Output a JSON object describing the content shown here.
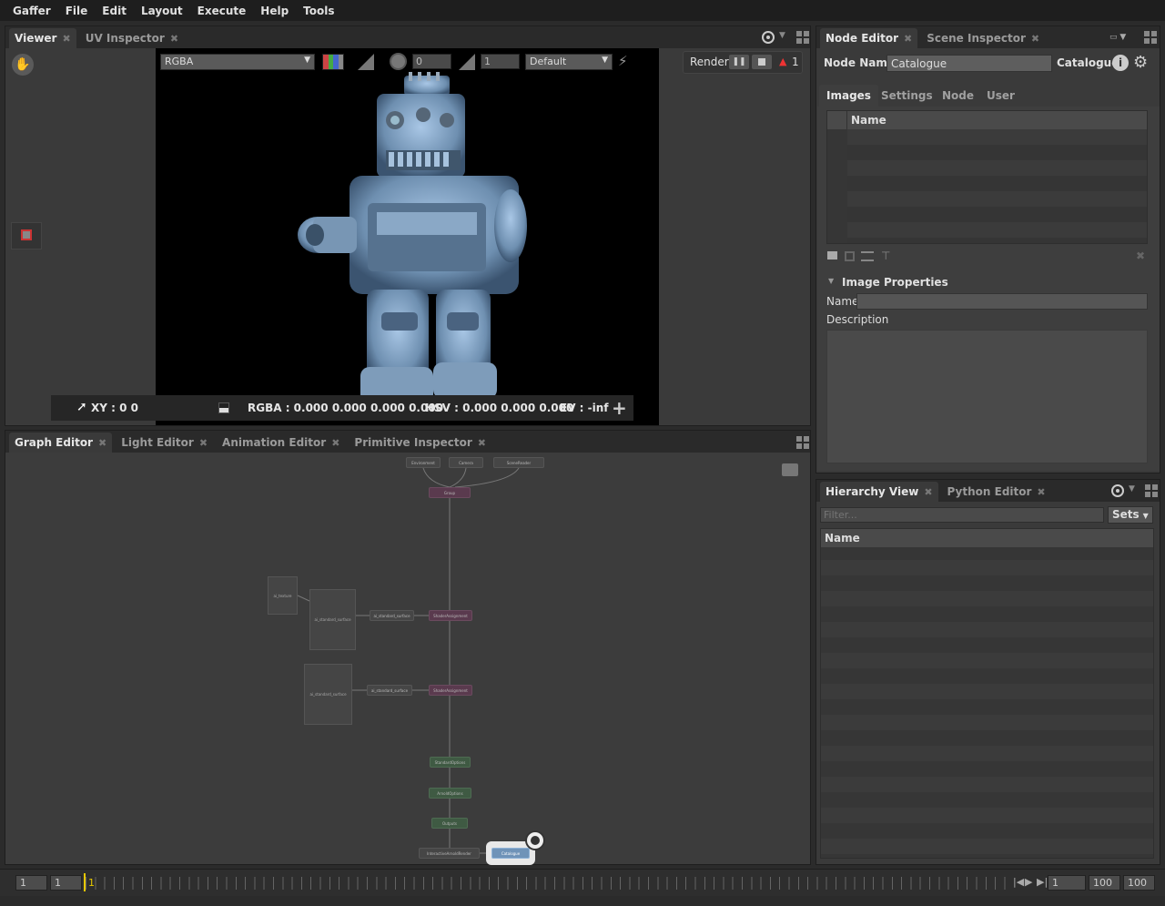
{
  "menubar": [
    "Gaffer",
    "File",
    "Edit",
    "Layout",
    "Execute",
    "Help",
    "Tools"
  ],
  "viewer": {
    "tabs": [
      {
        "label": "Viewer"
      },
      {
        "label": "UV Inspector"
      }
    ],
    "channels": "RGBA",
    "exposure": "0",
    "gamma": "1",
    "display": "Default",
    "render_label": "Render",
    "error_count": "1",
    "pixel": {
      "xy": "XY : 0 0",
      "rgba": "RGBA : 0.000 0.000 0.000 0.000",
      "hsv": "HSV : 0.000 0.000 0.000",
      "ev": "EV : -inf"
    }
  },
  "node_editor": {
    "tabs": [
      {
        "label": "Node Editor"
      },
      {
        "label": "Scene Inspector"
      }
    ],
    "node_name_label": "Node Name",
    "node_name_value": "Catalogue",
    "node_type": "Catalogue",
    "subtabs": [
      "Images",
      "Settings",
      "Node",
      "User"
    ],
    "table_header": "Name",
    "section_title": "Image Properties",
    "name_label": "Name",
    "name_value": "",
    "description_label": "Description"
  },
  "graph_editor": {
    "tabs": [
      {
        "label": "Graph Editor"
      },
      {
        "label": "Light Editor"
      },
      {
        "label": "Animation Editor"
      },
      {
        "label": "Primitive Inspector"
      }
    ],
    "nodes": {
      "top1": "Environment",
      "top2": "Camera",
      "top3": "SceneReader",
      "group": "Group",
      "shader1": "ai_texture",
      "shader2": "ai_standard_surface",
      "assign1a": "ai_standard_surface",
      "assign1b": "ShaderAssignment",
      "shader3": "ai_standard_surface",
      "assign2a": "ai_standard_surface",
      "assign2b": "ShaderAssignment",
      "opt1": "StandardOptions",
      "opt2": "ArnoldOptions",
      "outputs": "Outputs",
      "render": "InteractiveArnoldRender",
      "catalogue": "Catalogue"
    }
  },
  "hierarchy": {
    "tabs": [
      {
        "label": "Hierarchy View"
      },
      {
        "label": "Python Editor"
      }
    ],
    "filter_placeholder": "Filter...",
    "sets_label": "Sets",
    "column": "Name"
  },
  "timeline": {
    "start": "1",
    "range_start": "1",
    "current_marker": "1",
    "frame": "1",
    "range_end": "100",
    "end": "100"
  },
  "colors": {
    "accent": "#e6c700",
    "catalogue_node": "#6f93b8",
    "shader_node": "#5a3a4e",
    "options_node": "#3f5a43"
  }
}
